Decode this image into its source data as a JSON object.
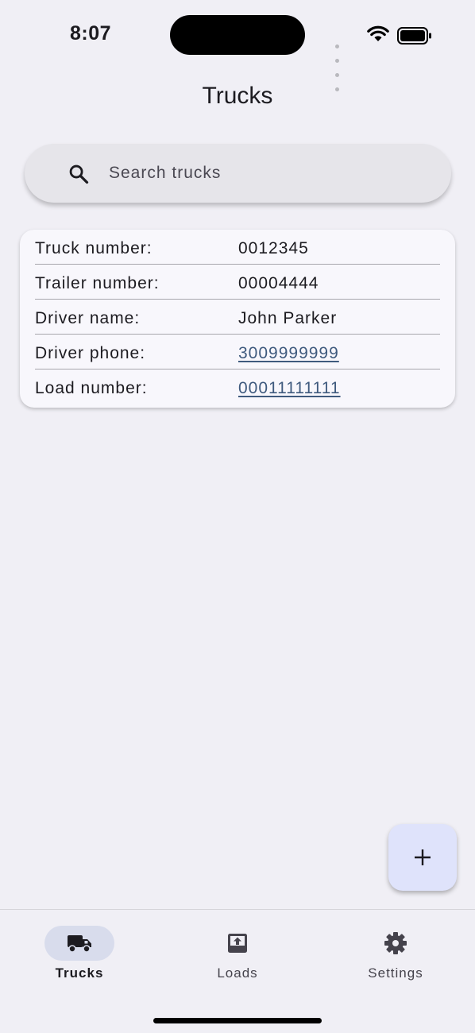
{
  "status_bar": {
    "time": "8:07"
  },
  "header": {
    "title": "Trucks"
  },
  "search": {
    "placeholder": "Search trucks",
    "value": ""
  },
  "truck_card": {
    "rows": [
      {
        "label": "Truck number:",
        "value": "0012345"
      },
      {
        "label": "Trailer number:",
        "value": "00004444"
      },
      {
        "label": "Driver name:",
        "value": "John Parker"
      },
      {
        "label": "Driver phone:",
        "value": "3009999999"
      },
      {
        "label": "Load number:",
        "value": "00011111111"
      }
    ]
  },
  "fab": {
    "icon": "plus-icon"
  },
  "bottom_nav": {
    "items": [
      {
        "label": "Trucks",
        "icon": "truck-icon",
        "active": true
      },
      {
        "label": "Loads",
        "icon": "upload-box-icon",
        "active": false
      },
      {
        "label": "Settings",
        "icon": "gear-icon",
        "active": false
      }
    ]
  },
  "colors": {
    "background": "#f0eff5",
    "link": "#3f5a7e",
    "active_nav_pill": "#d8dcec",
    "fab": "#dfe3fb"
  }
}
